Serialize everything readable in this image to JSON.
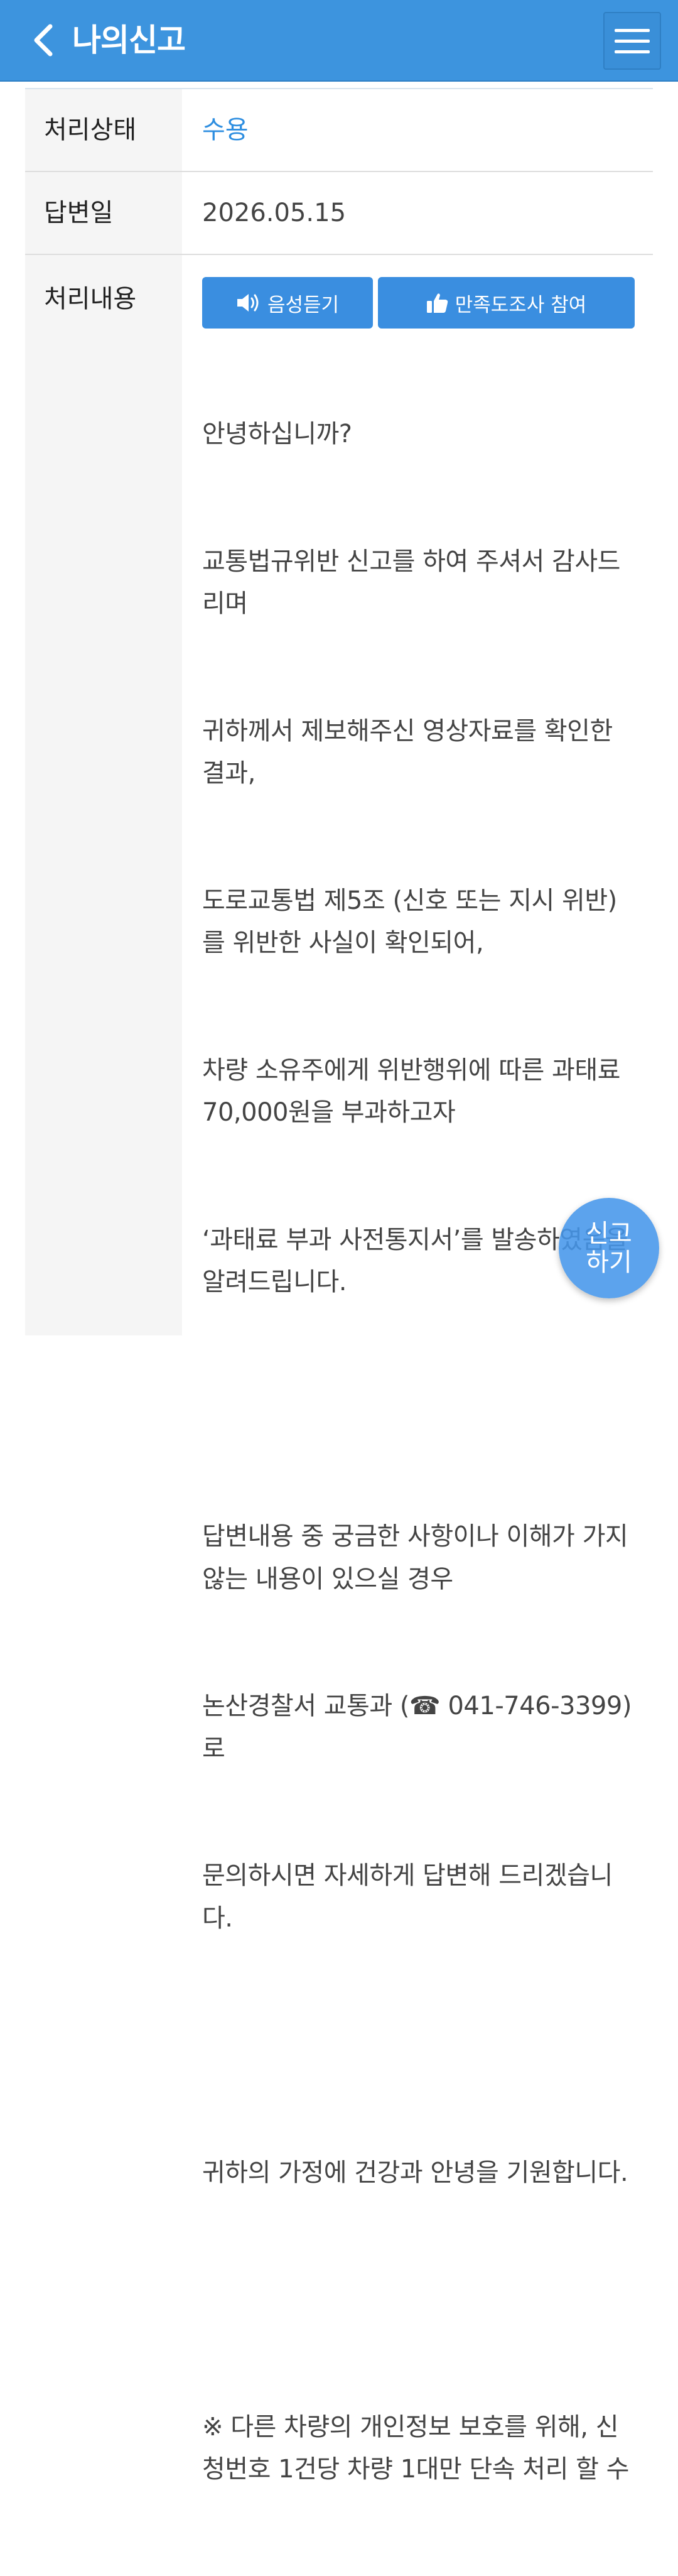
{
  "header": {
    "title": "나의신고",
    "back_icon": "chevron-left-icon",
    "menu_icon": "hamburger-menu-icon"
  },
  "details": {
    "status_label": "처리상태",
    "status_value": "수용",
    "answer_date_label": "답변일",
    "answer_date_value": "2026.05.15",
    "content_label": "처리내용"
  },
  "actions": {
    "listen_label": "음성듣기",
    "listen_icon": "speaker-icon",
    "survey_label": "만족도조사 참여",
    "survey_icon": "thumbs-up-icon"
  },
  "content": {
    "lines": [
      "안녕하십니까?",
      "교통법규위반 신고를 하여 주셔서 감사드리며",
      "귀하께서 제보해주신 영상자료를 확인한 결과,",
      "도로교통법 제5조 (신호 또는 지시 위반)를 위반한 사실이 확인되어,",
      "차량 소유주에게 위반행위에 따른 과태료 70,000원을 부과하고자",
      "‘과태료 부과 사전통지서’를 발송하였음을 알려드립니다.",
      "",
      "답변내용 중 궁금한 사항이나 이해가 가지 않는 내용이 있으실 경우",
      "논산경찰서 교통과 (☎ 041-746-3399)로",
      "문의하시면 자세하게 답변해 드리겠습니다.",
      "",
      "귀하의 가정에 건강과 안녕을 기원합니다.",
      "",
      "※ 다른 차량의 개인정보 보호를 위해, 신청번호 1건당 차량 1대만 단속 처리 할 수"
    ]
  },
  "fab": {
    "label_line1": "신고",
    "label_line2": "하기"
  },
  "colors": {
    "header_bg": "#3d94de",
    "accent": "#3a8ee0",
    "status_text": "#2e8ee0"
  }
}
